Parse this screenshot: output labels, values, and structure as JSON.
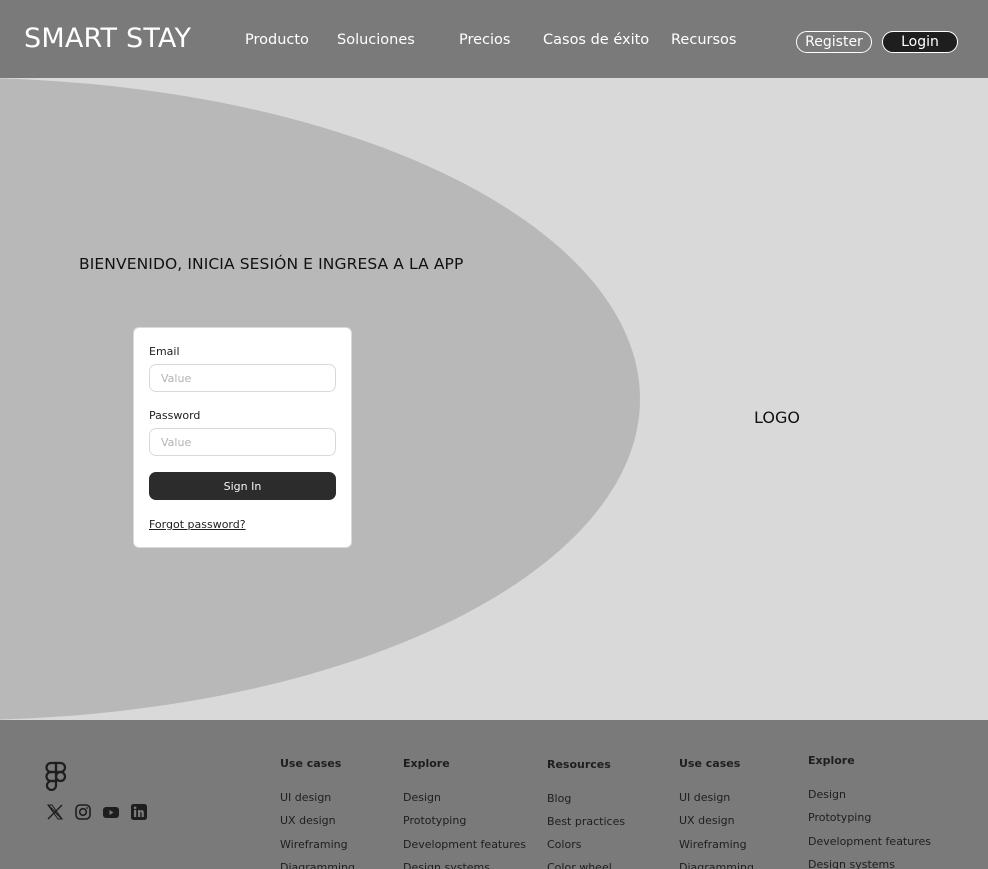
{
  "header": {
    "brand": "SMART STAY",
    "nav": [
      "Producto",
      "Soluciones",
      "Precios",
      "Casos de éxito",
      "Recursos"
    ],
    "register_label": "Register",
    "login_label": "Login"
  },
  "hero": {
    "welcome": "BIENVENIDO, INICIA SESIÓN E INGRESA A LA APP",
    "logo_text": "LOGO"
  },
  "login_form": {
    "email_label": "Email",
    "email_placeholder": "Value",
    "password_label": "Password",
    "password_placeholder": "Value",
    "signin_label": "Sign In",
    "forgot_label": "Forgot password?"
  },
  "footer": {
    "social_icons": [
      "x-icon",
      "instagram-icon",
      "youtube-icon",
      "linkedin-icon"
    ],
    "columns": [
      {
        "title": "Use cases",
        "links": [
          "UI design",
          "UX design",
          "Wireframing",
          "Diagramming"
        ]
      },
      {
        "title": "Explore",
        "links": [
          "Design",
          "Prototyping",
          "Development features",
          "Design systems"
        ]
      },
      {
        "title": "Resources",
        "links": [
          "Blog",
          "Best practices",
          "Colors",
          "Color wheel"
        ]
      },
      {
        "title": "Use cases",
        "links": [
          "UI design",
          "UX design",
          "Wireframing",
          "Diagramming"
        ]
      },
      {
        "title": "Explore",
        "links": [
          "Design",
          "Prototyping",
          "Development features",
          "Design systems"
        ]
      }
    ]
  },
  "colors": {
    "header_bg": "#7a7a7a",
    "hero_bg": "#d9d9d9",
    "ellipse": "#b8b8b8",
    "button_dark": "#2c2c2c"
  }
}
